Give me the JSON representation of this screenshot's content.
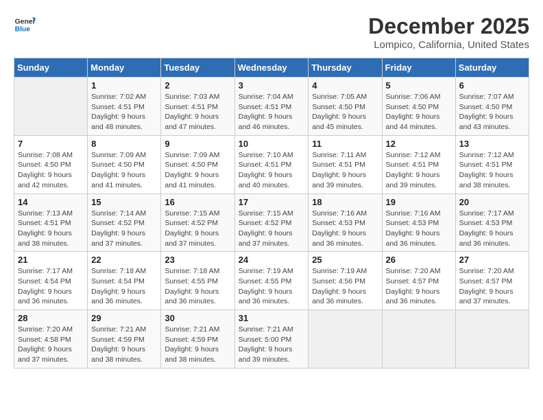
{
  "logo": {
    "line1": "General",
    "line2": "Blue"
  },
  "title": "December 2025",
  "subtitle": "Lompico, California, United States",
  "days_of_week": [
    "Sunday",
    "Monday",
    "Tuesday",
    "Wednesday",
    "Thursday",
    "Friday",
    "Saturday"
  ],
  "weeks": [
    [
      {
        "day": "",
        "sunrise": "",
        "sunset": "",
        "daylight": ""
      },
      {
        "day": "1",
        "sunrise": "Sunrise: 7:02 AM",
        "sunset": "Sunset: 4:51 PM",
        "daylight": "Daylight: 9 hours and 48 minutes."
      },
      {
        "day": "2",
        "sunrise": "Sunrise: 7:03 AM",
        "sunset": "Sunset: 4:51 PM",
        "daylight": "Daylight: 9 hours and 47 minutes."
      },
      {
        "day": "3",
        "sunrise": "Sunrise: 7:04 AM",
        "sunset": "Sunset: 4:51 PM",
        "daylight": "Daylight: 9 hours and 46 minutes."
      },
      {
        "day": "4",
        "sunrise": "Sunrise: 7:05 AM",
        "sunset": "Sunset: 4:50 PM",
        "daylight": "Daylight: 9 hours and 45 minutes."
      },
      {
        "day": "5",
        "sunrise": "Sunrise: 7:06 AM",
        "sunset": "Sunset: 4:50 PM",
        "daylight": "Daylight: 9 hours and 44 minutes."
      },
      {
        "day": "6",
        "sunrise": "Sunrise: 7:07 AM",
        "sunset": "Sunset: 4:50 PM",
        "daylight": "Daylight: 9 hours and 43 minutes."
      }
    ],
    [
      {
        "day": "7",
        "sunrise": "Sunrise: 7:08 AM",
        "sunset": "Sunset: 4:50 PM",
        "daylight": "Daylight: 9 hours and 42 minutes."
      },
      {
        "day": "8",
        "sunrise": "Sunrise: 7:09 AM",
        "sunset": "Sunset: 4:50 PM",
        "daylight": "Daylight: 9 hours and 41 minutes."
      },
      {
        "day": "9",
        "sunrise": "Sunrise: 7:09 AM",
        "sunset": "Sunset: 4:50 PM",
        "daylight": "Daylight: 9 hours and 41 minutes."
      },
      {
        "day": "10",
        "sunrise": "Sunrise: 7:10 AM",
        "sunset": "Sunset: 4:51 PM",
        "daylight": "Daylight: 9 hours and 40 minutes."
      },
      {
        "day": "11",
        "sunrise": "Sunrise: 7:11 AM",
        "sunset": "Sunset: 4:51 PM",
        "daylight": "Daylight: 9 hours and 39 minutes."
      },
      {
        "day": "12",
        "sunrise": "Sunrise: 7:12 AM",
        "sunset": "Sunset: 4:51 PM",
        "daylight": "Daylight: 9 hours and 39 minutes."
      },
      {
        "day": "13",
        "sunrise": "Sunrise: 7:12 AM",
        "sunset": "Sunset: 4:51 PM",
        "daylight": "Daylight: 9 hours and 38 minutes."
      }
    ],
    [
      {
        "day": "14",
        "sunrise": "Sunrise: 7:13 AM",
        "sunset": "Sunset: 4:51 PM",
        "daylight": "Daylight: 9 hours and 38 minutes."
      },
      {
        "day": "15",
        "sunrise": "Sunrise: 7:14 AM",
        "sunset": "Sunset: 4:52 PM",
        "daylight": "Daylight: 9 hours and 37 minutes."
      },
      {
        "day": "16",
        "sunrise": "Sunrise: 7:15 AM",
        "sunset": "Sunset: 4:52 PM",
        "daylight": "Daylight: 9 hours and 37 minutes."
      },
      {
        "day": "17",
        "sunrise": "Sunrise: 7:15 AM",
        "sunset": "Sunset: 4:52 PM",
        "daylight": "Daylight: 9 hours and 37 minutes."
      },
      {
        "day": "18",
        "sunrise": "Sunrise: 7:16 AM",
        "sunset": "Sunset: 4:53 PM",
        "daylight": "Daylight: 9 hours and 36 minutes."
      },
      {
        "day": "19",
        "sunrise": "Sunrise: 7:16 AM",
        "sunset": "Sunset: 4:53 PM",
        "daylight": "Daylight: 9 hours and 36 minutes."
      },
      {
        "day": "20",
        "sunrise": "Sunrise: 7:17 AM",
        "sunset": "Sunset: 4:53 PM",
        "daylight": "Daylight: 9 hours and 36 minutes."
      }
    ],
    [
      {
        "day": "21",
        "sunrise": "Sunrise: 7:17 AM",
        "sunset": "Sunset: 4:54 PM",
        "daylight": "Daylight: 9 hours and 36 minutes."
      },
      {
        "day": "22",
        "sunrise": "Sunrise: 7:18 AM",
        "sunset": "Sunset: 4:54 PM",
        "daylight": "Daylight: 9 hours and 36 minutes."
      },
      {
        "day": "23",
        "sunrise": "Sunrise: 7:18 AM",
        "sunset": "Sunset: 4:55 PM",
        "daylight": "Daylight: 9 hours and 36 minutes."
      },
      {
        "day": "24",
        "sunrise": "Sunrise: 7:19 AM",
        "sunset": "Sunset: 4:55 PM",
        "daylight": "Daylight: 9 hours and 36 minutes."
      },
      {
        "day": "25",
        "sunrise": "Sunrise: 7:19 AM",
        "sunset": "Sunset: 4:56 PM",
        "daylight": "Daylight: 9 hours and 36 minutes."
      },
      {
        "day": "26",
        "sunrise": "Sunrise: 7:20 AM",
        "sunset": "Sunset: 4:57 PM",
        "daylight": "Daylight: 9 hours and 36 minutes."
      },
      {
        "day": "27",
        "sunrise": "Sunrise: 7:20 AM",
        "sunset": "Sunset: 4:57 PM",
        "daylight": "Daylight: 9 hours and 37 minutes."
      }
    ],
    [
      {
        "day": "28",
        "sunrise": "Sunrise: 7:20 AM",
        "sunset": "Sunset: 4:58 PM",
        "daylight": "Daylight: 9 hours and 37 minutes."
      },
      {
        "day": "29",
        "sunrise": "Sunrise: 7:21 AM",
        "sunset": "Sunset: 4:59 PM",
        "daylight": "Daylight: 9 hours and 38 minutes."
      },
      {
        "day": "30",
        "sunrise": "Sunrise: 7:21 AM",
        "sunset": "Sunset: 4:59 PM",
        "daylight": "Daylight: 9 hours and 38 minutes."
      },
      {
        "day": "31",
        "sunrise": "Sunrise: 7:21 AM",
        "sunset": "Sunset: 5:00 PM",
        "daylight": "Daylight: 9 hours and 39 minutes."
      },
      {
        "day": "",
        "sunrise": "",
        "sunset": "",
        "daylight": ""
      },
      {
        "day": "",
        "sunrise": "",
        "sunset": "",
        "daylight": ""
      },
      {
        "day": "",
        "sunrise": "",
        "sunset": "",
        "daylight": ""
      }
    ]
  ]
}
